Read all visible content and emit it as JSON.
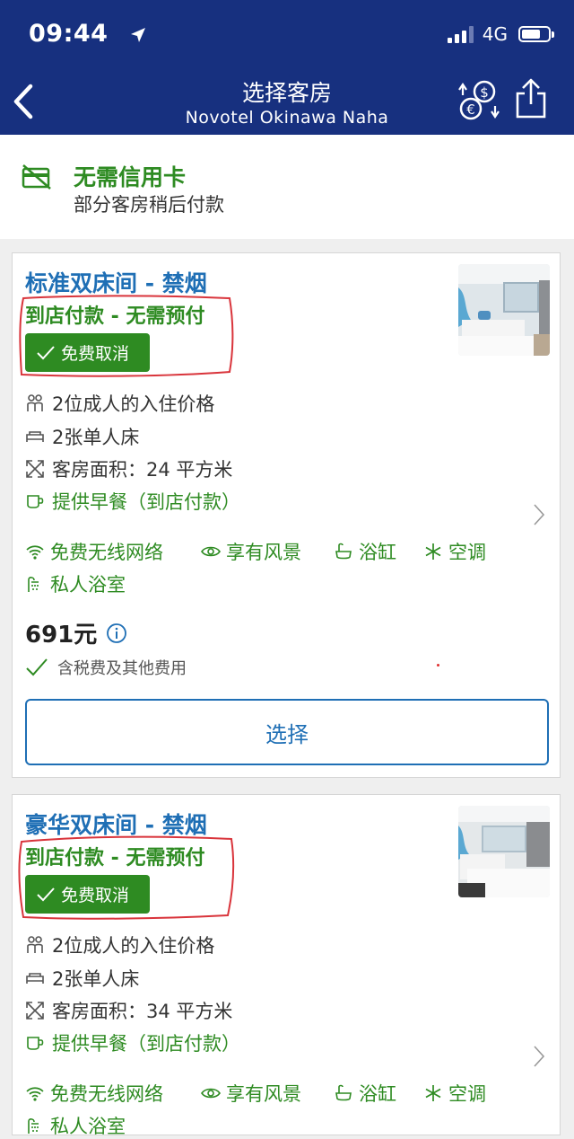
{
  "status_bar": {
    "time": "09:44",
    "network": "4G"
  },
  "header": {
    "title": "选择客房",
    "subtitle": "Novotel Okinawa Naha"
  },
  "banner": {
    "title": "无需信用卡",
    "subtitle": "部分客房稍后付款"
  },
  "rooms": [
    {
      "name": "标准双床间 - 禁烟",
      "payment": "到店付款 - 无需预付",
      "cancel_badge": "免费取消",
      "occupancy": "2位成人的入住价格",
      "beds": "2张单人床",
      "area": "客房面积：24 平方米",
      "breakfast": "提供早餐（到店付款）",
      "amenities": [
        "免费无线网络",
        "享有风景",
        "浴缸",
        "空调",
        "私人浴室"
      ],
      "price": "691元",
      "tax_note": "含税费及其他费用",
      "select_label": "选择"
    },
    {
      "name": "豪华双床间 - 禁烟",
      "payment": "到店付款 - 无需预付",
      "cancel_badge": "免费取消",
      "occupancy": "2位成人的入住价格",
      "beds": "2张单人床",
      "area": "客房面积：34 平方米",
      "breakfast": "提供早餐（到店付款）",
      "amenities": [
        "免费无线网络",
        "享有风景",
        "浴缸",
        "空调",
        "私人浴室"
      ]
    }
  ],
  "colors": {
    "header_bg": "#17307f",
    "green": "#2e8b22",
    "link_blue": "#1f6fb5",
    "annotation_red": "#d9343b"
  }
}
